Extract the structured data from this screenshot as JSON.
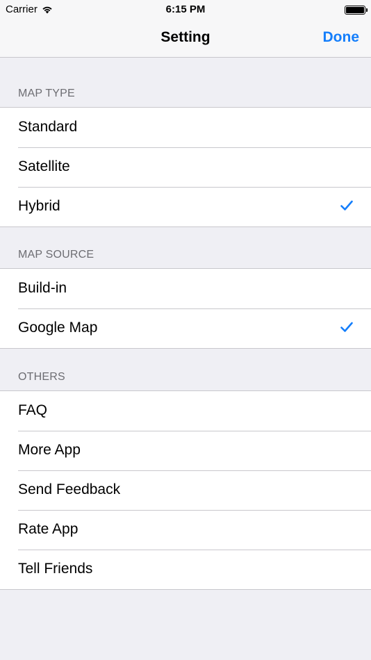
{
  "status": {
    "carrier": "Carrier",
    "time": "6:15 PM"
  },
  "nav": {
    "title": "Setting",
    "done": "Done"
  },
  "accent": "#147efb",
  "sections": [
    {
      "header": "MAP TYPE",
      "items": [
        {
          "label": "Standard",
          "checked": false
        },
        {
          "label": "Satellite",
          "checked": false
        },
        {
          "label": "Hybrid",
          "checked": true
        }
      ]
    },
    {
      "header": "MAP SOURCE",
      "items": [
        {
          "label": "Build-in",
          "checked": false
        },
        {
          "label": "Google Map",
          "checked": true
        }
      ]
    },
    {
      "header": "OTHERS",
      "items": [
        {
          "label": "FAQ"
        },
        {
          "label": "More App"
        },
        {
          "label": "Send Feedback"
        },
        {
          "label": "Rate App"
        },
        {
          "label": "Tell Friends"
        }
      ]
    }
  ]
}
